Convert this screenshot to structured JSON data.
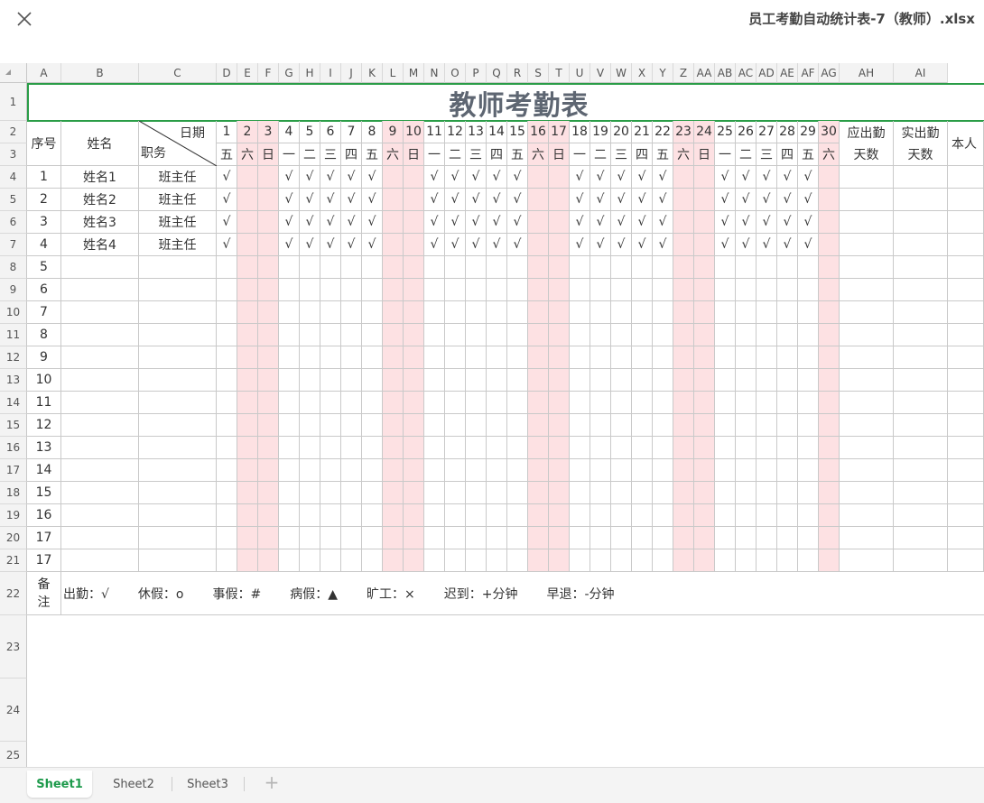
{
  "window": {
    "title": "员工考勤自动统计表-7（教师）.xlsx",
    "close_icon": "close-icon"
  },
  "columns": [
    "A",
    "B",
    "C",
    "D",
    "E",
    "F",
    "G",
    "H",
    "I",
    "J",
    "K",
    "L",
    "M",
    "N",
    "O",
    "P",
    "Q",
    "R",
    "S",
    "T",
    "U",
    "V",
    "W",
    "X",
    "Y",
    "Z",
    "AA",
    "AB",
    "AC",
    "AD",
    "AE",
    "AF",
    "AG",
    "AH",
    "AI"
  ],
  "rows": [
    "1",
    "2",
    "3",
    "4",
    "5",
    "6",
    "7",
    "8",
    "9",
    "10",
    "11",
    "12",
    "13",
    "14",
    "15",
    "16",
    "17",
    "18",
    "19",
    "20",
    "21",
    "22",
    "23",
    "24",
    "25"
  ],
  "sheet": {
    "title": "教师考勤表",
    "header": {
      "seq": "序号",
      "name": "姓名",
      "date_label": "日期",
      "role_label": "职务",
      "due_days_1": "应出勤",
      "due_days_2": "天数",
      "actual_days_1": "实出勤",
      "actual_days_2": "天数",
      "self_partial": "本人"
    },
    "dates": [
      "1",
      "2",
      "3",
      "4",
      "5",
      "6",
      "7",
      "8",
      "9",
      "10",
      "11",
      "12",
      "13",
      "14",
      "15",
      "16",
      "17",
      "18",
      "19",
      "20",
      "21",
      "22",
      "23",
      "24",
      "25",
      "26",
      "27",
      "28",
      "29",
      "30"
    ],
    "weekdays": [
      "五",
      "六",
      "日",
      "一",
      "二",
      "三",
      "四",
      "五",
      "六",
      "日",
      "一",
      "二",
      "三",
      "四",
      "五",
      "六",
      "日",
      "一",
      "二",
      "三",
      "四",
      "五",
      "六",
      "日",
      "一",
      "二",
      "三",
      "四",
      "五",
      "六"
    ],
    "weekend_day_indexes": [
      1,
      2,
      8,
      9,
      15,
      16,
      22,
      23,
      29
    ],
    "weekend_color": "#fde1e3",
    "title_border_color": "#2a9d47",
    "employees": [
      {
        "seq": "1",
        "name": "姓名1",
        "role": "班主任"
      },
      {
        "seq": "2",
        "name": "姓名2",
        "role": "班主任"
      },
      {
        "seq": "3",
        "name": "姓名3",
        "role": "班主任"
      },
      {
        "seq": "4",
        "name": "姓名4",
        "role": "班主任"
      }
    ],
    "check_mark": "√",
    "empty_seq": [
      "5",
      "6",
      "7",
      "8",
      "9",
      "10",
      "11",
      "12",
      "13",
      "14",
      "15",
      "16",
      "17",
      "17"
    ],
    "notes": {
      "label": "备注",
      "items": [
        "出勤：√",
        "休假：ο",
        "事假：#",
        "病假：▲",
        "旷工：×",
        "迟到：+分钟",
        "早退：-分钟"
      ]
    }
  },
  "tabs": [
    {
      "label": "Sheet1",
      "active": true
    },
    {
      "label": "Sheet2",
      "active": false
    },
    {
      "label": "Sheet3",
      "active": false
    }
  ],
  "add_sheet_icon": "plus-icon",
  "accent_color": "#1d9a4b"
}
